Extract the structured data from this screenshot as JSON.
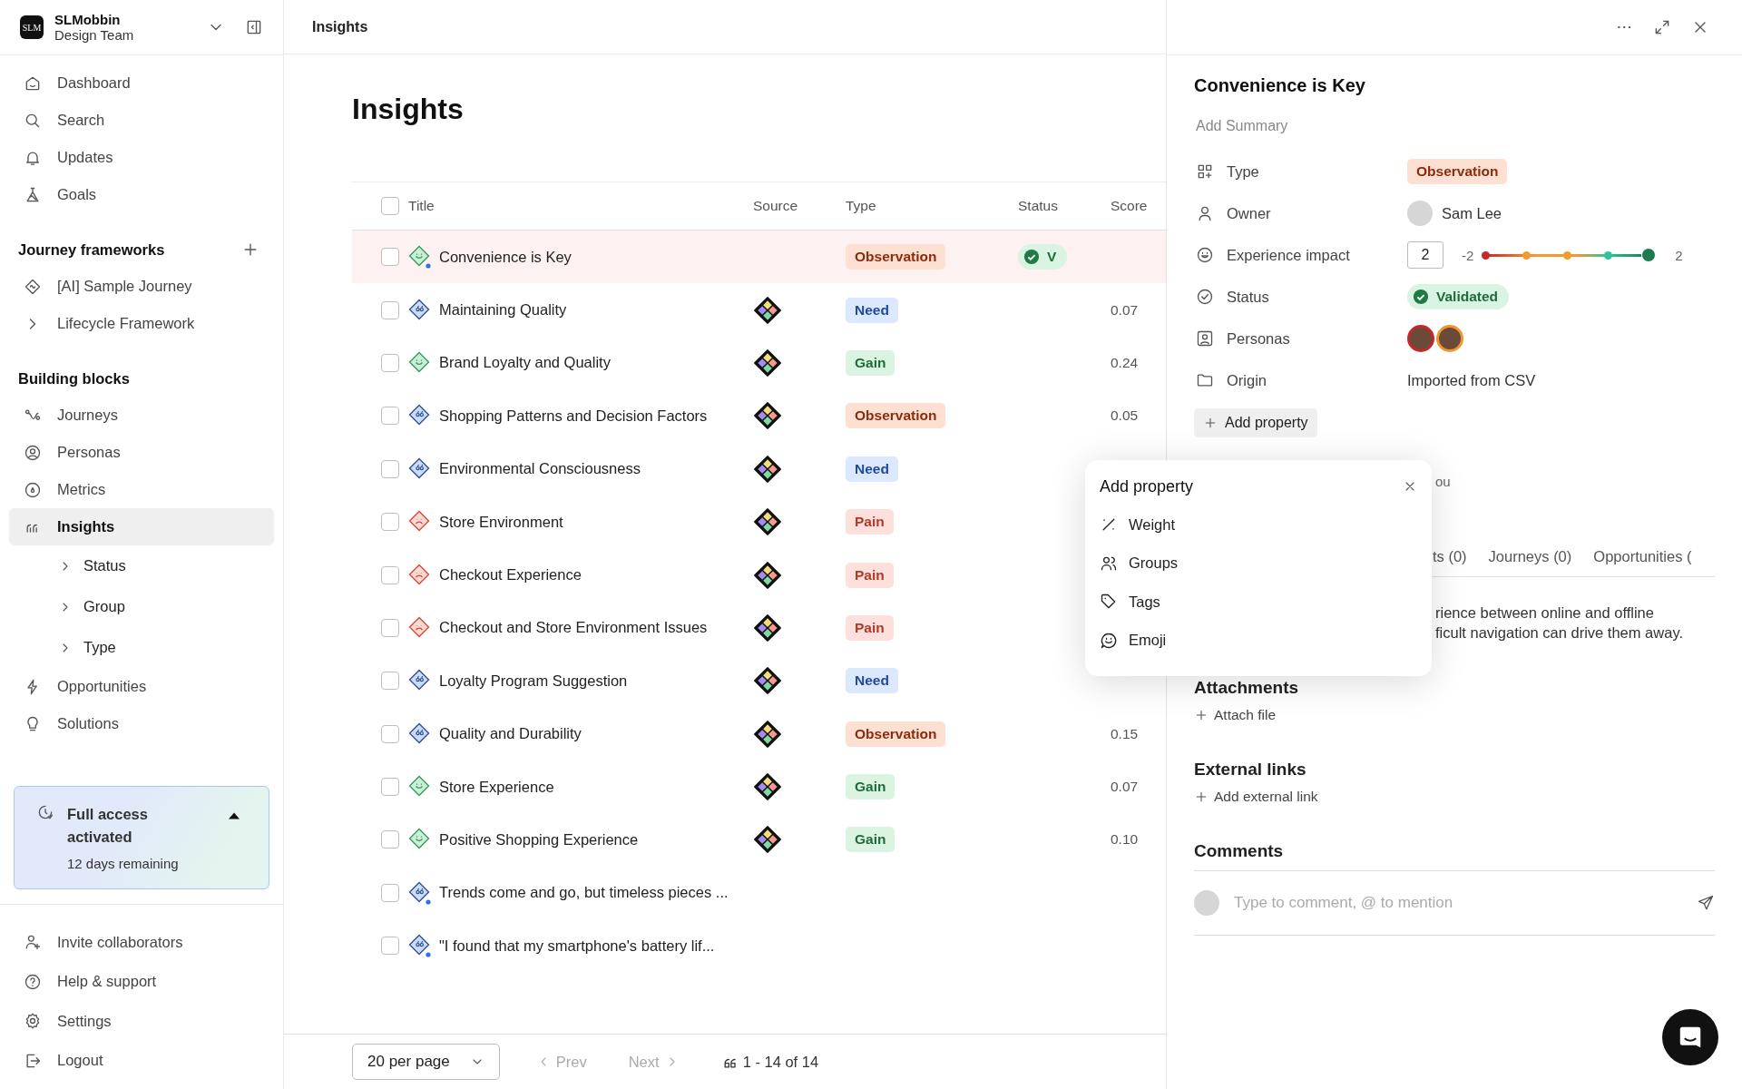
{
  "sidebar": {
    "workspace": {
      "logo": "SLM",
      "name": "SLMobbin",
      "team": "Design Team"
    },
    "nav": [
      {
        "label": "Dashboard",
        "selected": false
      },
      {
        "label": "Search",
        "selected": false
      },
      {
        "label": "Updates",
        "selected": false
      },
      {
        "label": "Goals",
        "selected": false
      }
    ],
    "sections": [
      {
        "title": "Journey frameworks",
        "items": [
          {
            "label": "[AI] Sample Journey",
            "selected": false
          },
          {
            "label": "Lifecycle Framework",
            "selected": false,
            "expanded": false
          }
        ]
      },
      {
        "title": "Building blocks",
        "items": [
          {
            "label": "Journeys",
            "selected": false
          },
          {
            "label": "Personas",
            "selected": false
          },
          {
            "label": "Metrics",
            "selected": false
          },
          {
            "label": "Insights",
            "selected": true,
            "children": [
              {
                "label": "Status",
                "expanded": false
              },
              {
                "label": "Group",
                "expanded": false
              },
              {
                "label": "Type",
                "expanded": false
              }
            ]
          },
          {
            "label": "Opportunities",
            "selected": false
          },
          {
            "label": "Solutions",
            "selected": false
          }
        ]
      }
    ],
    "trial": {
      "title": "Full access activated",
      "subtitle": "12 days remaining",
      "expanded": true
    },
    "footer_items": [
      {
        "label": "Invite collaborators"
      },
      {
        "label": "Help & support"
      },
      {
        "label": "Settings"
      },
      {
        "label": "Logout"
      }
    ]
  },
  "header": {
    "breadcrumb": "Insights"
  },
  "page_title": "Insights",
  "table": {
    "all_checked": false,
    "columns": [
      "Title",
      "Source",
      "Type",
      "Status",
      "Score"
    ],
    "rows": [
      {
        "title": "Convenience is Key",
        "checked": false,
        "selected": true,
        "kind": "positive",
        "unread": true,
        "source": false,
        "type": {
          "label": "Observation",
          "kind": "observation"
        },
        "status": "V"
      },
      {
        "title": "Maintaining Quality",
        "checked": false,
        "selected": false,
        "kind": "neutral",
        "unread": false,
        "source": true,
        "type": {
          "label": "Need",
          "kind": "need"
        },
        "score": "0.07"
      },
      {
        "title": "Brand Loyalty and Quality",
        "checked": false,
        "selected": false,
        "kind": "positive",
        "unread": false,
        "source": true,
        "type": {
          "label": "Gain",
          "kind": "gain"
        },
        "score": "0.24"
      },
      {
        "title": "Shopping Patterns and Decision Factors",
        "checked": false,
        "selected": false,
        "kind": "neutral",
        "unread": false,
        "source": true,
        "type": {
          "label": "Observation",
          "kind": "observation"
        },
        "score": "0.05"
      },
      {
        "title": "Environmental Consciousness",
        "checked": false,
        "selected": false,
        "kind": "neutral",
        "unread": false,
        "source": true,
        "type": {
          "label": "Need",
          "kind": "need"
        }
      },
      {
        "title": "Store Environment",
        "checked": false,
        "selected": false,
        "kind": "negative",
        "unread": false,
        "source": true,
        "type": {
          "label": "Pain",
          "kind": "pain"
        }
      },
      {
        "title": "Checkout Experience",
        "checked": false,
        "selected": false,
        "kind": "negative",
        "unread": false,
        "source": true,
        "type": {
          "label": "Pain",
          "kind": "pain"
        }
      },
      {
        "title": "Checkout and Store Environment Issues",
        "checked": false,
        "selected": false,
        "kind": "negative",
        "unread": false,
        "source": true,
        "type": {
          "label": "Pain",
          "kind": "pain"
        }
      },
      {
        "title": "Loyalty Program Suggestion",
        "checked": false,
        "selected": false,
        "kind": "neutral",
        "unread": false,
        "source": true,
        "type": {
          "label": "Need",
          "kind": "need"
        }
      },
      {
        "title": "Quality and Durability",
        "checked": false,
        "selected": false,
        "kind": "neutral",
        "unread": false,
        "source": true,
        "type": {
          "label": "Observation",
          "kind": "observation"
        },
        "score": "0.15"
      },
      {
        "title": "Store Experience",
        "checked": false,
        "selected": false,
        "kind": "positive",
        "unread": false,
        "source": true,
        "type": {
          "label": "Gain",
          "kind": "gain"
        },
        "score": "0.07"
      },
      {
        "title": "Positive Shopping Experience",
        "checked": false,
        "selected": false,
        "kind": "positive",
        "unread": false,
        "source": true,
        "type": {
          "label": "Gain",
          "kind": "gain"
        },
        "score": "0.10"
      },
      {
        "title": "Trends come and go, but timeless pieces ...",
        "checked": false,
        "selected": false,
        "kind": "neutral",
        "unread": true,
        "source": false
      },
      {
        "title": "\"I found that my smartphone's battery lif...",
        "checked": false,
        "selected": false,
        "kind": "neutral",
        "unread": true,
        "source": false
      }
    ]
  },
  "pagination": {
    "per_page": "20 per page",
    "prev": "Prev",
    "next": "Next",
    "prev_disabled": true,
    "next_disabled": true,
    "range": "1 - 14 of 14"
  },
  "detail": {
    "title": "Convenience is Key",
    "summary_placeholder": "Add Summary",
    "properties": [
      {
        "label": "Type",
        "kind": "badge",
        "badge": {
          "label": "Observation",
          "kind": "observation"
        }
      },
      {
        "label": "Owner",
        "kind": "person",
        "value": "Sam Lee"
      },
      {
        "label": "Experience impact",
        "kind": "impact",
        "value": "2",
        "min": "-2",
        "max": "2",
        "level": 1
      },
      {
        "label": "Status",
        "kind": "status",
        "value": "Validated"
      },
      {
        "label": "Personas",
        "kind": "personas",
        "personas": [
          {
            "color": "#c62828"
          },
          {
            "color": "#f0962e"
          }
        ]
      },
      {
        "label": "Origin",
        "kind": "text",
        "value": "Imported from CSV"
      }
    ],
    "add_property": "Add property",
    "hidden_fragment": "ou",
    "tabs": [
      {
        "label": "ts (0)",
        "selected": false
      },
      {
        "label": "Journeys (0)",
        "selected": false
      },
      {
        "label": "Opportunities (",
        "selected": false
      }
    ],
    "description": [
      "rience between online and offline",
      "ficult navigation can drive them away."
    ],
    "attachments": {
      "title": "Attachments",
      "action": "Attach file"
    },
    "links": {
      "title": "External links",
      "action": "Add external link"
    },
    "comments": {
      "title": "Comments",
      "placeholder": "Type to comment, @ to mention"
    }
  },
  "popover": {
    "title": "Add property",
    "items": [
      {
        "label": "Weight"
      },
      {
        "label": "Groups"
      },
      {
        "label": "Tags"
      },
      {
        "label": "Emoji"
      }
    ]
  }
}
